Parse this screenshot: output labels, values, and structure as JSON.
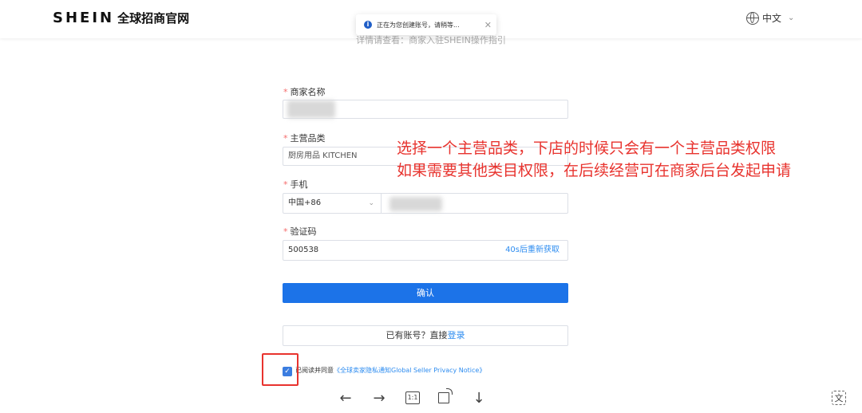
{
  "header": {
    "logo_brand": "SHEIN",
    "logo_sub": "全球招商官网",
    "language": "中文"
  },
  "toast": {
    "message": "正在为您创建账号，请稍等..."
  },
  "faint_text": "详情请查看：商家入驻SHEIN操作指引",
  "form": {
    "merchant_name": {
      "label": "商家名称",
      "value": ""
    },
    "main_category": {
      "label": "主营品类",
      "value": "厨房用品 KITCHEN"
    },
    "phone": {
      "label": "手机",
      "country_code": "中国+86",
      "value": ""
    },
    "code": {
      "label": "验证码",
      "value": "500538",
      "resend": "40s后重新获取"
    },
    "confirm_label": "确认",
    "have_account": "已有账号？直接",
    "login_link": "登录",
    "agree_text": "已阅读并同意",
    "privacy_link": "《全球卖家隐私通知Global Seller Privacy Notice》"
  },
  "annotation": {
    "line1": "选择一个主营品类，下店的时候只会有一个主营品类权限",
    "line2": "如果需要其他类目权限，在后续经营可在商家后台发起申请"
  },
  "viewer": {
    "prev": "←",
    "next": "→",
    "actual_size": "1:1",
    "download": "↓",
    "translate": "文"
  },
  "colors": {
    "primary": "#1c73e8",
    "link": "#2d8cf0",
    "annotation": "#e8332e",
    "required": "#f56c6c"
  }
}
